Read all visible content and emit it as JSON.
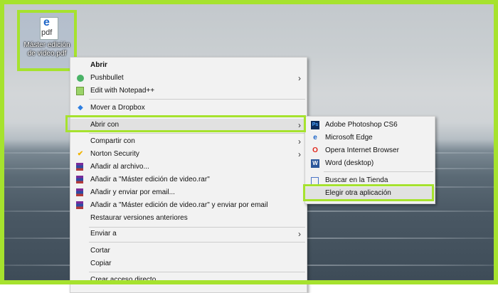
{
  "desktop": {
    "file": {
      "icon_text": "pdf",
      "name": "Máster edición de video.pdf"
    }
  },
  "context_menu": {
    "items": [
      {
        "label": "Abrir",
        "icon": "none",
        "bold": true
      },
      {
        "label": "Pushbullet",
        "icon": "pushbullet-icon",
        "submenu": true
      },
      {
        "label": "Edit with Notepad++",
        "icon": "notepad-icon"
      },
      {
        "label": "Mover a Dropbox",
        "icon": "dropbox-icon"
      },
      {
        "label": "Abrir con",
        "icon": "none",
        "submenu": true
      },
      {
        "label": "Compartir con",
        "icon": "none",
        "submenu": true
      },
      {
        "label": "Norton Security",
        "icon": "norton-icon",
        "submenu": true
      },
      {
        "label": "Añadir al archivo...",
        "icon": "winrar-icon"
      },
      {
        "label": "Añadir a \"Máster edición de video.rar\"",
        "icon": "winrar-icon"
      },
      {
        "label": "Añadir y enviar por email...",
        "icon": "winrar-icon"
      },
      {
        "label": "Añadir a \"Máster edición de video.rar\" y enviar por email",
        "icon": "winrar-icon"
      },
      {
        "label": "Restaurar versiones anteriores",
        "icon": "none"
      },
      {
        "label": "Enviar a",
        "icon": "none",
        "submenu": true
      },
      {
        "label": "Cortar",
        "icon": "none"
      },
      {
        "label": "Copiar",
        "icon": "none"
      },
      {
        "label": "Crear acceso directo",
        "icon": "none"
      }
    ]
  },
  "submenu": {
    "items": [
      {
        "label": "Adobe Photoshop CS6",
        "icon": "photoshop-icon"
      },
      {
        "label": "Microsoft Edge",
        "icon": "edge-icon"
      },
      {
        "label": "Opera Internet Browser",
        "icon": "opera-icon"
      },
      {
        "label": "Word (desktop)",
        "icon": "word-icon"
      },
      {
        "label": "Buscar en la Tienda",
        "icon": "store-icon"
      },
      {
        "label": "Elegir otra aplicación",
        "icon": "none"
      }
    ]
  },
  "colors": {
    "highlight_border": "#a6e22e",
    "menu_background": "#f2f2f2",
    "hover_row": "#e1e1e1"
  }
}
